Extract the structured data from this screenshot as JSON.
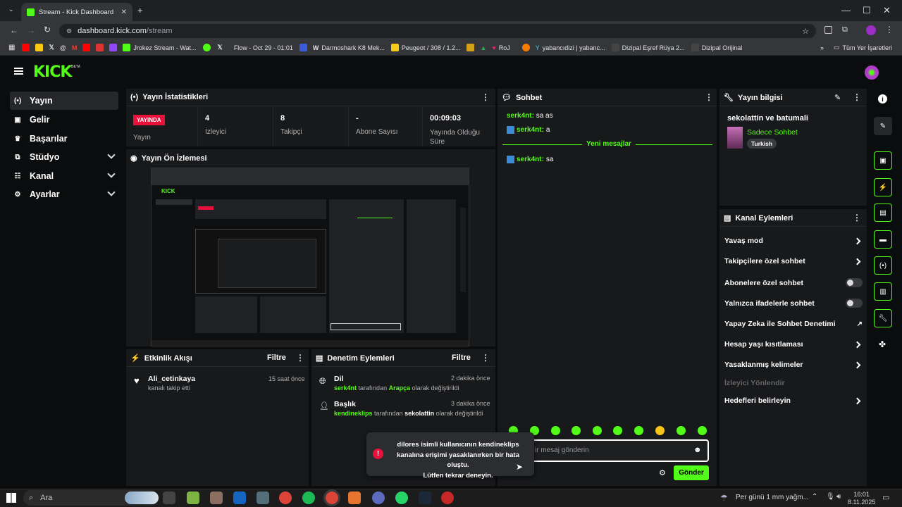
{
  "browser": {
    "tab_title": "Stream - Kick Dashboard",
    "url_host": "dashboard.kick.com",
    "url_path": "/stream",
    "bookmarks": [
      "Jrokez Stream - Wat...",
      "Flow - Oct 29 - 01:01",
      "Darmoshark K8 Mek...",
      "Peugeot / 308 / 1.2...",
      "RoJ",
      "yabancıdizi | yabanc...",
      "Dizipal Eşref Rüya 2...",
      "Dizipal Orijinal"
    ],
    "all_bookmarks": "Tüm Yer İşaretleri"
  },
  "app": {
    "logo": "KICK",
    "beta": "BETA"
  },
  "sidebar": {
    "items": [
      {
        "label": "Yayın",
        "icon": "broadcast-icon",
        "active": true
      },
      {
        "label": "Gelir",
        "icon": "wallet-icon"
      },
      {
        "label": "Başarılar",
        "icon": "trophy-icon"
      },
      {
        "label": "Stüdyo",
        "icon": "studio-icon",
        "expand": true
      },
      {
        "label": "Kanal",
        "icon": "channel-icon",
        "expand": true
      },
      {
        "label": "Ayarlar",
        "icon": "gear-icon",
        "expand": true
      }
    ]
  },
  "stats": {
    "title": "Yayın İstatistikleri",
    "live_badge": "YAYINDA",
    "live_label": "Yayın",
    "viewers_value": "4",
    "viewers_label": "İzleyici",
    "followers_value": "8",
    "followers_label": "Takipçi",
    "subs_value": "-",
    "subs_label": "Abone Sayısı",
    "duration_value": "00:09:03",
    "duration_label": "Yayında Olduğu Süre"
  },
  "preview": {
    "title": "Yayın Ön İzlemesi"
  },
  "activity": {
    "title": "Etkinlik Akışı",
    "filter": "Filtre",
    "user": "Ali_cetinkaya",
    "text": "kanalı takip etti",
    "time": "15 saat önce"
  },
  "moderation": {
    "title": "Denetim Eylemleri",
    "filter": "Filtre",
    "items": [
      {
        "heading": "Dil",
        "time": "2 dakika önce",
        "actor": "serk4nt",
        "mid": "tarafından",
        "value": "Arapça",
        "end": "olarak değiştirildi"
      },
      {
        "heading": "Başlık",
        "time": "3 dakika önce",
        "actor": "kendineklips",
        "mid": "tarafından",
        "value": "sekolattin",
        "end": "olarak değiştirildi"
      }
    ]
  },
  "chat": {
    "title": "Sohbet",
    "messages": [
      {
        "user": "serk4nt:",
        "text": "sa as"
      },
      {
        "user": "serk4nt:",
        "text": "a"
      },
      {
        "user": "serk4nt:",
        "text": "sa"
      }
    ],
    "divider": "Yeni mesajlar",
    "placeholder": "ir mesaj gönderin",
    "send": "Gönder"
  },
  "toast": {
    "line1": "dilores isimli kullanıcının kendineklips",
    "line2": "kanalına erişimi yasaklanırken bir hata oluştu.",
    "line3": "Lütfen tekrar deneyin."
  },
  "stream_info": {
    "title": "Yayın bilgisi",
    "stream_title": "sekolattin ve batumali",
    "category": "Sadece Sohbet",
    "tag": "Turkish"
  },
  "channel_actions": {
    "title": "Kanal Eylemleri",
    "items": [
      {
        "label": "Yavaş mod",
        "kind": "arrow"
      },
      {
        "label": "Takipçilere özel sohbet",
        "kind": "arrow"
      },
      {
        "label": "Abonelere özel sohbet",
        "kind": "toggle"
      },
      {
        "label": "Yalnızca ifadelerle sohbet",
        "kind": "toggle"
      },
      {
        "label": "Yapay Zeka ile Sohbet Denetimi",
        "kind": "external"
      },
      {
        "label": "Hesap yaşı kısıtlaması",
        "kind": "arrow"
      },
      {
        "label": "Yasaklanmış kelimeler",
        "kind": "arrow"
      },
      {
        "label": "İzleyici Yönlendir",
        "kind": "disabled"
      },
      {
        "label": "Hedefleri belirleyin",
        "kind": "arrow"
      }
    ]
  },
  "taskbar": {
    "search": "Ara",
    "weather": "Per günü 1 mm yağm...",
    "time": "16:01",
    "date": "8.11.2025"
  },
  "colors": {
    "accent": "#53fc18",
    "live": "#e9113c",
    "panel": "#18191b"
  }
}
